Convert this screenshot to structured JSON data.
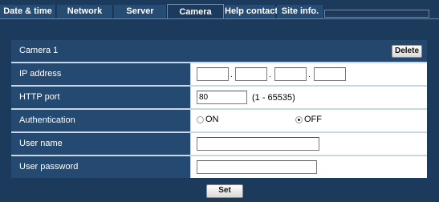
{
  "tabs": [
    {
      "label": "Date & time",
      "active": false
    },
    {
      "label": "Network",
      "active": false
    },
    {
      "label": "Server",
      "active": false
    },
    {
      "label": "Camera",
      "active": true
    },
    {
      "label": "Help contact",
      "active": false
    },
    {
      "label": "Site info.",
      "active": false
    }
  ],
  "panel": {
    "title": "Camera 1",
    "delete_label": "Delete",
    "rows": {
      "ip_address": {
        "label": "IP address",
        "octets": [
          "",
          "",
          "",
          ""
        ],
        "separator": "."
      },
      "http_port": {
        "label": "HTTP port",
        "value": "80",
        "range_hint": "(1 - 65535)"
      },
      "authentication": {
        "label": "Authentication",
        "option_on": "ON",
        "option_off": "OFF",
        "selected": "OFF"
      },
      "user_name": {
        "label": "User name",
        "value": ""
      },
      "user_password": {
        "label": "User password",
        "value": ""
      }
    }
  },
  "set_label": "Set",
  "colors": {
    "background": "#1c3a5c",
    "tab": "#274c74",
    "label_cell": "#244a72",
    "panel_border": "#c9d6e5"
  }
}
